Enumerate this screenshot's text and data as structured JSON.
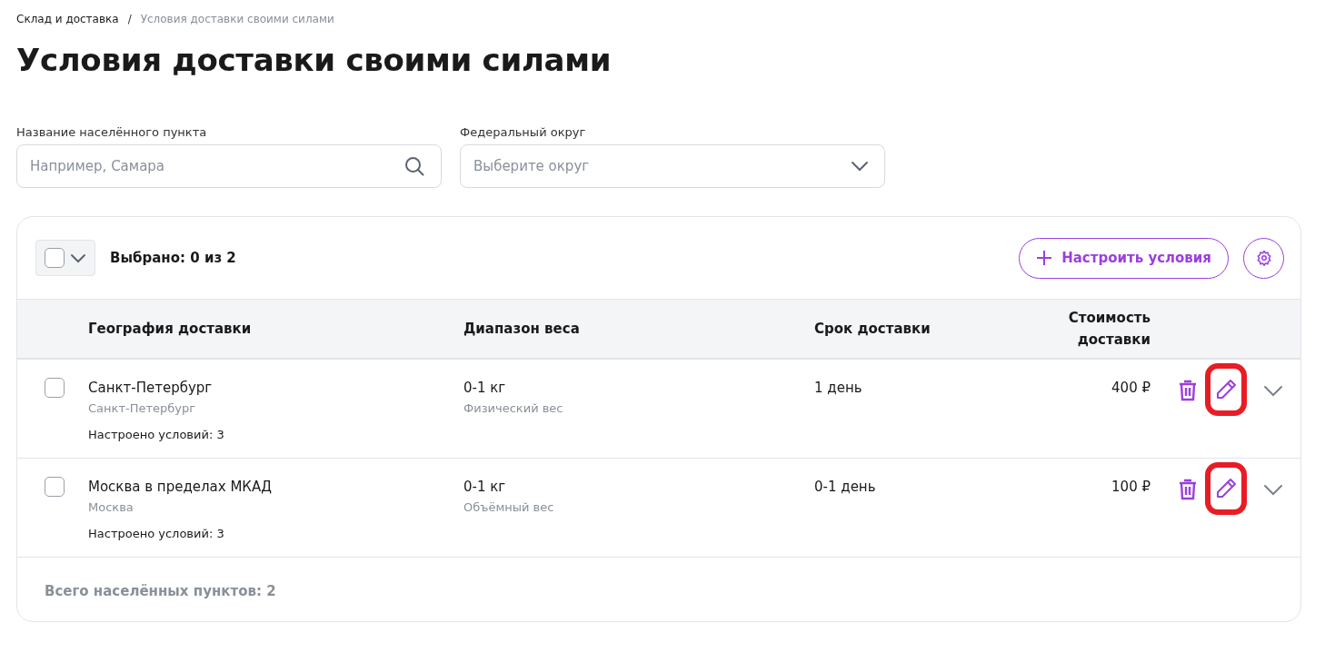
{
  "breadcrumbs": [
    {
      "label": "Склад и доставка",
      "current": false
    },
    {
      "label": "Условия доставки своими силами",
      "current": true
    }
  ],
  "breadcrumb_separator": "/",
  "title": "Условия доставки своими силами",
  "filters": [
    {
      "kind": "search",
      "label": "Название населённого пункта",
      "placeholder": "Например, Самара"
    },
    {
      "kind": "select",
      "label": "Федеральный округ",
      "placeholder": "Выберите округ"
    }
  ],
  "toolbar": {
    "select_all_checked": false,
    "selected_text": "Выбрано: 0 из 2",
    "configure_button": "Настроить условия"
  },
  "table": {
    "columns": [
      "География доставки",
      "Диапазон веса",
      "Срок доставки",
      "Стоимость доставки"
    ],
    "rows": [
      {
        "checked": false,
        "city": "Санкт-Петербург",
        "region": "Санкт-Петербург",
        "conditions": "Настроено условий: 3",
        "weight": "0-1 кг",
        "weight_type": "Физический вес",
        "term": "1 день",
        "cost": "400 ₽",
        "edit_highlighted": true
      },
      {
        "checked": false,
        "city": "Москва в пределах МКАД",
        "region": "Москва",
        "conditions": "Настроено условий: 3",
        "weight": "0-1 кг",
        "weight_type": "Объёмный вес",
        "term": "0-1 день",
        "cost": "100 ₽",
        "edit_highlighted": true
      }
    ]
  },
  "footer": "Всего населённых пунктов: 2"
}
